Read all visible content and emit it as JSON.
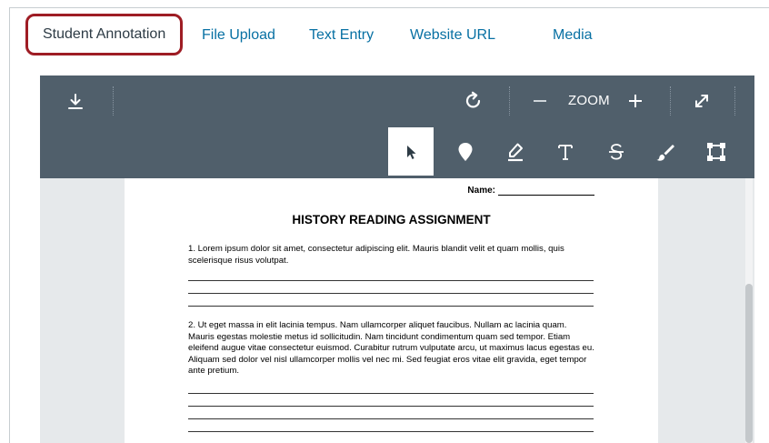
{
  "tabs": [
    {
      "label": "Student Annotation",
      "active": true
    },
    {
      "label": "File Upload",
      "active": false
    },
    {
      "label": "Text Entry",
      "active": false
    },
    {
      "label": "Website URL",
      "active": false
    },
    {
      "label": "Media",
      "active": false
    }
  ],
  "toolbar": {
    "zoom_label": "ZOOM",
    "icons": {
      "download": "download-icon",
      "rotate": "rotate-icon",
      "zoom_out": "minus-icon",
      "zoom_in": "plus-icon",
      "fullscreen": "expand-icon"
    },
    "tools": [
      "pointer-tool",
      "point-tool",
      "highlight-tool",
      "text-tool",
      "strikeout-tool",
      "draw-tool",
      "area-tool"
    ],
    "active_tool": "pointer-tool"
  },
  "document": {
    "name_label": "Name:",
    "title": "HISTORY READING ASSIGNMENT",
    "q1": "1. Lorem ipsum dolor sit amet, consectetur adipiscing elit. Mauris blandit velit et quam mollis, quis scelerisque risus volutpat.",
    "q2": "2. Ut eget massa in elit lacinia tempus. Nam ullamcorper aliquet faucibus. Nullam ac lacinia quam. Mauris egestas molestie metus id sollicitudin. Nam tincidunt condimentum quam sed tempor. Etiam eleifend augue vitae consectetur euismod. Curabitur rutrum vulputate arcu, ut maximus lacus egestas eu. Aliquam sed dolor vel nisl ullamcorper mollis vel nec mi. Sed feugiat eros vitae elit gravida, eget tempor ante pretium."
  },
  "colors": {
    "toolbar_bg": "#505f6b",
    "link_blue": "#0770a3",
    "active_tab_border": "#9e1c24",
    "viewer_bg": "#e6e9eb"
  }
}
